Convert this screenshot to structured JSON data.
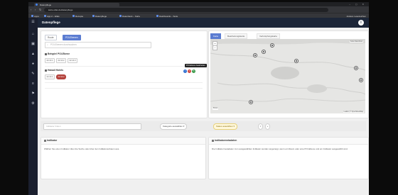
{
  "browser": {
    "tab_title": "Datenpflege",
    "url": "karte.ellas.de/datenpflege",
    "window_controls": "– ▢ ✕",
    "bookmarks": [
      "Apps",
      "App 2 – Ellas",
      "Rezepte",
      "Datenpflege",
      "Datenbank – Karte",
      "Dashboards – Suite"
    ],
    "profile_label": "Andere Lesezeichen"
  },
  "app": {
    "title": "Datenpflege",
    "avatar_letter": "i"
  },
  "sidebar": {
    "icons": [
      "menu",
      "home",
      "bus",
      "car",
      "walk",
      "edit",
      "layers",
      "flag",
      "settings"
    ]
  },
  "left_panel": {
    "radios": [
      {
        "label": "Route",
        "active": false
      },
      {
        "label": "POI-Ebenen",
        "active": true
      }
    ],
    "search_placeholder": "POI-Ebenen durchsuchen",
    "groups": [
      {
        "title": "Beispiel POI-Ebene",
        "chips": [
          "22.10.1",
          "22.10.2",
          "22.10.3"
        ]
      },
      {
        "title": "Hawaii Hotels",
        "chips": [
          "22.10.1",
          "22.10.2"
        ],
        "selected_index": 1
      }
    ],
    "tooltip": "POI-Ebene bearbeiten",
    "controls": [
      {
        "name": "info",
        "glyph": "i",
        "color": "#2f6fd0"
      },
      {
        "name": "delete",
        "glyph": "×",
        "color": "#d0453d"
      },
      {
        "name": "edit",
        "glyph": "✎",
        "color": "#3a9a4a"
      }
    ]
  },
  "map_panel": {
    "tabs": [
      {
        "label": "Karte",
        "active": true
      },
      {
        "label": "Bearbeitungskarte",
        "active": false
      },
      {
        "label": "Verknüpfungskarte",
        "active": false
      }
    ],
    "zoom_in": "+",
    "zoom_out": "−",
    "lens_label": "Karte Datenfluss",
    "scale_label": "50 km",
    "attribution": "Leaflet | © OpenStreetMap"
  },
  "filter_bar": {
    "search_placeholder": "Indikator finden",
    "category_filter": "Kategorie auswählen",
    "status_filter": "Status auswählen",
    "reset_glyph": "×",
    "add_glyph": "+",
    "dropdown_glyph": "▾"
  },
  "bottom": {
    "left": {
      "title": "Indikator",
      "body": "Wählen Sie einen Indikator über die Suche oder über den Indikatorenbaum aus."
    },
    "right": {
      "title": "Indikatormetadaten",
      "body": "Die Indikatormetadaten zum ausgewählten Indikator werden angezeigt, wenn ein Raum oder eine POI-Ebene und ein Indikator ausgewählt sind."
    }
  },
  "colors": {
    "accent": "#5b7cd1",
    "selected_chip": "#b4433d",
    "appbar": "#1c2638",
    "sidebar": "#1a1f2e"
  }
}
